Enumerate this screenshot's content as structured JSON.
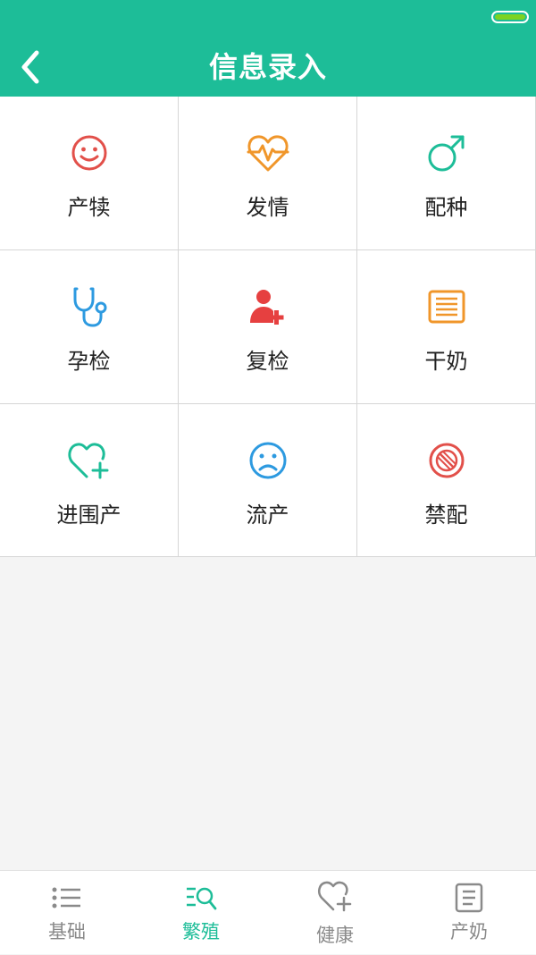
{
  "header": {
    "title": "信息录入",
    "back_label": "back"
  },
  "colors": {
    "primary": "#1dbd98",
    "battery": "#7dd321"
  },
  "grid": {
    "items": [
      {
        "label": "产犊",
        "icon": "smile-icon",
        "color": "#e2504a"
      },
      {
        "label": "发情",
        "icon": "heart-pulse-icon",
        "color": "#f0962a"
      },
      {
        "label": "配种",
        "icon": "male-symbol-icon",
        "color": "#1dbd98"
      },
      {
        "label": "孕检",
        "icon": "stethoscope-icon",
        "color": "#2d9ae0"
      },
      {
        "label": "复检",
        "icon": "user-plus-icon",
        "color": "#e64040"
      },
      {
        "label": "干奶",
        "icon": "list-icon",
        "color": "#f0962a"
      },
      {
        "label": "进围产",
        "icon": "heart-plus-icon",
        "color": "#1dbd98"
      },
      {
        "label": "流产",
        "icon": "sad-face-icon",
        "color": "#2d9ae0"
      },
      {
        "label": "禁配",
        "icon": "forbidden-icon",
        "color": "#e2504a"
      }
    ]
  },
  "tabbar": {
    "active": 1,
    "items": [
      {
        "label": "基础",
        "icon": "list-icon"
      },
      {
        "label": "繁殖",
        "icon": "search-list-icon"
      },
      {
        "label": "健康",
        "icon": "heart-plus-icon"
      },
      {
        "label": "产奶",
        "icon": "document-icon"
      }
    ]
  }
}
